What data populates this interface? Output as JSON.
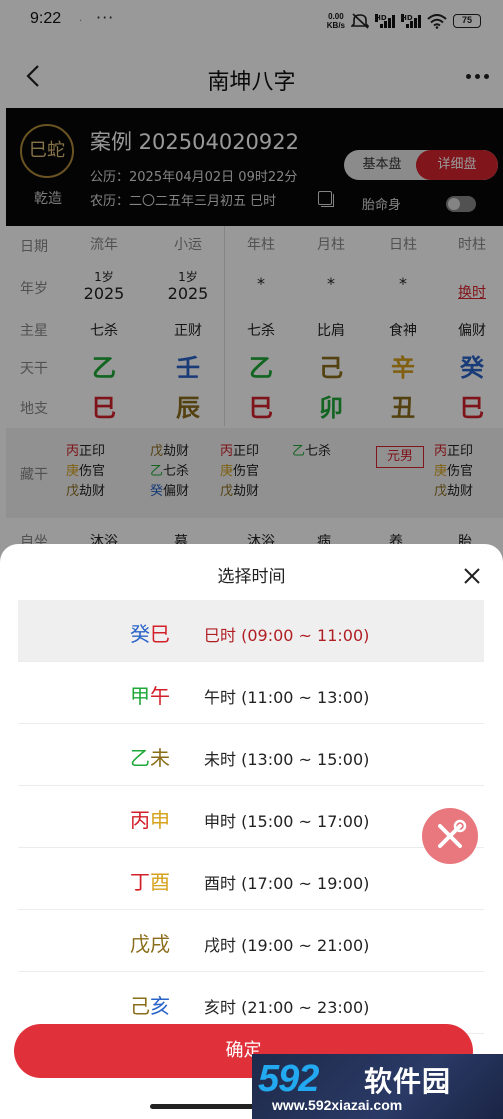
{
  "status_bar": {
    "time": "9:22",
    "dot": ".",
    "more": "···",
    "speed_top": "0.00",
    "speed_bottom": "KB/s",
    "hd1": "HD",
    "hd2": "HD",
    "battery": "75"
  },
  "nav": {
    "title": "南坤八字"
  },
  "header": {
    "zodiac": "巳蛇",
    "gender": "乾造",
    "case_title": "案例 202504020922",
    "solar": "公历：2025年04月02日 09时22分",
    "lunar": "农历：二〇二五年三月初五 巳时",
    "toggle_basic": "基本盘",
    "toggle_detail": "详细盘",
    "fetal_label": "胎命身"
  },
  "table": {
    "row_labels": [
      "日期",
      "年岁",
      "主星",
      "天干",
      "地支",
      "藏干"
    ],
    "status_row_label": "自坐",
    "columns": [
      {
        "header": "流年",
        "age": "1岁",
        "year": "2025",
        "star": "七杀",
        "stem": "乙",
        "stem_color": "#1fa838",
        "branch": "巳",
        "branch_color": "#d2202a"
      },
      {
        "header": "小运",
        "age": "1岁",
        "year": "2025",
        "star": "正财",
        "stem": "壬",
        "stem_color": "#2a64c8",
        "branch": "辰",
        "branch_color": "#8a6d1a"
      },
      {
        "header": "年柱",
        "mark": "*",
        "star": "七杀",
        "stem": "乙",
        "stem_color": "#1fa838",
        "branch": "巳",
        "branch_color": "#d2202a"
      },
      {
        "header": "月柱",
        "mark": "*",
        "star": "比肩",
        "stem": "己",
        "stem_color": "#8a6d1a",
        "branch": "卯",
        "branch_color": "#1fa838"
      },
      {
        "header": "日柱",
        "mark": "*",
        "star": "食神",
        "stem": "辛",
        "stem_color": "#d6a11c",
        "branch": "丑",
        "branch_color": "#8a6d1a"
      },
      {
        "header": "时柱",
        "change": "换时",
        "star": "偏财",
        "stem": "癸",
        "stem_color": "#2a64c8",
        "branch": "巳",
        "branch_color": "#d2202a"
      }
    ],
    "hidden_stems": [
      [
        {
          "g": "丙",
          "c": "#d2202a",
          "t": "正印"
        },
        {
          "g": "庚",
          "c": "#d6a11c",
          "t": "伤官"
        },
        {
          "g": "戊",
          "c": "#8a6d1a",
          "t": "劫财"
        }
      ],
      [
        {
          "g": "戊",
          "c": "#8a6d1a",
          "t": "劫财"
        },
        {
          "g": "乙",
          "c": "#1fa838",
          "t": "七杀"
        },
        {
          "g": "癸",
          "c": "#2a64c8",
          "t": "偏财"
        }
      ],
      [
        {
          "g": "丙",
          "c": "#d2202a",
          "t": "正印"
        },
        {
          "g": "庚",
          "c": "#d6a11c",
          "t": "伤官"
        },
        {
          "g": "戊",
          "c": "#8a6d1a",
          "t": "劫财"
        }
      ],
      [
        {
          "g": "乙",
          "c": "#1fa838",
          "t": "七杀"
        }
      ],
      [],
      [
        {
          "g": "丙",
          "c": "#d2202a",
          "t": "正印"
        },
        {
          "g": "庚",
          "c": "#d6a11c",
          "t": "伤官"
        },
        {
          "g": "戊",
          "c": "#8a6d1a",
          "t": "劫财"
        }
      ]
    ],
    "gender_tag": "元男",
    "stages": [
      "沐浴",
      "墓",
      "沐浴",
      "病",
      "养",
      "胎"
    ]
  },
  "sheet": {
    "title": "选择时间",
    "items": [
      {
        "g1": "癸",
        "c1": "#2a64c8",
        "g2": "巳",
        "c2": "#d2202a",
        "hour": "巳时 (09:00 ~ 11:00)",
        "selected": true
      },
      {
        "g1": "甲",
        "c1": "#1fa838",
        "g2": "午",
        "c2": "#d2202a",
        "hour": "午时 (11:00 ~ 13:00)"
      },
      {
        "g1": "乙",
        "c1": "#1fa838",
        "g2": "未",
        "c2": "#8a6d1a",
        "hour": "未时 (13:00 ~ 15:00)"
      },
      {
        "g1": "丙",
        "c1": "#d2202a",
        "g2": "申",
        "c2": "#d6a11c",
        "hour": "申时 (15:00 ~ 17:00)"
      },
      {
        "g1": "丁",
        "c1": "#d2202a",
        "g2": "酉",
        "c2": "#d6a11c",
        "hour": "酉时 (17:00 ~ 19:00)"
      },
      {
        "g1": "戊",
        "c1": "#8a6d1a",
        "g2": "戌",
        "c2": "#8a6d1a",
        "hour": "戌时 (19:00 ~ 21:00)"
      },
      {
        "g1": "己",
        "c1": "#8a6d1a",
        "g2": "亥",
        "c2": "#2a64c8",
        "hour": "亥时 (21:00 ~ 23:00)"
      }
    ],
    "confirm": "确定"
  },
  "watermark": {
    "logo": "592",
    "name": "软件园",
    "url": "www.592xiazai.com"
  }
}
